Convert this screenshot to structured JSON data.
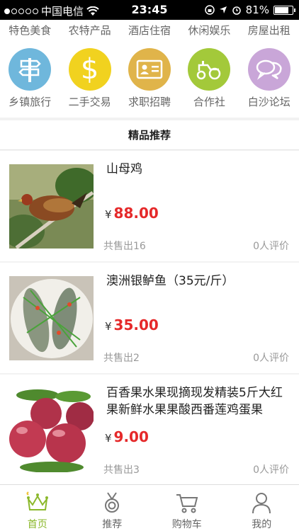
{
  "status": {
    "carrier": "中国电信",
    "time": "23:45",
    "battery": "81%",
    "battery_level": 0.81
  },
  "categories_top": [
    "特色美食",
    "农特产品",
    "酒店住宿",
    "休闲娱乐",
    "房屋出租"
  ],
  "categories": [
    {
      "label": "乡镇旅行",
      "icon": "signpost-icon",
      "color": "#6fb7dc"
    },
    {
      "label": "二手交易",
      "icon": "dollar-icon",
      "color": "#f1d21f"
    },
    {
      "label": "求职招聘",
      "icon": "id-card-icon",
      "color": "#e0b44a"
    },
    {
      "label": "合作社",
      "icon": "tractor-icon",
      "color": "#a3c93a"
    },
    {
      "label": "白沙论坛",
      "icon": "chat-bubbles-icon",
      "color": "#c9a6d8"
    }
  ],
  "section_title": "精品推荐",
  "currency": "¥",
  "products": [
    {
      "name": "山母鸡",
      "price": "88.00",
      "sold": "共售出16",
      "reviews": "0人评价",
      "image": "hen-photo"
    },
    {
      "name": "澳洲银鲈鱼（35元/斤）",
      "price": "35.00",
      "sold": "共售出2",
      "reviews": "0人评价",
      "image": "fish-photo"
    },
    {
      "name": "百香果水果现摘现发精装5斤大红果新鲜水果果酸西番莲鸡蛋果",
      "price": "9.00",
      "sold": "共售出3",
      "reviews": "0人评价",
      "image": "passionfruit-photo"
    }
  ],
  "tabs": [
    {
      "label": "首页",
      "icon": "crown-icon",
      "active": true
    },
    {
      "label": "推荐",
      "icon": "medal-icon",
      "active": false
    },
    {
      "label": "购物车",
      "icon": "cart-icon",
      "active": false
    },
    {
      "label": "我的",
      "icon": "person-icon",
      "active": false
    }
  ]
}
